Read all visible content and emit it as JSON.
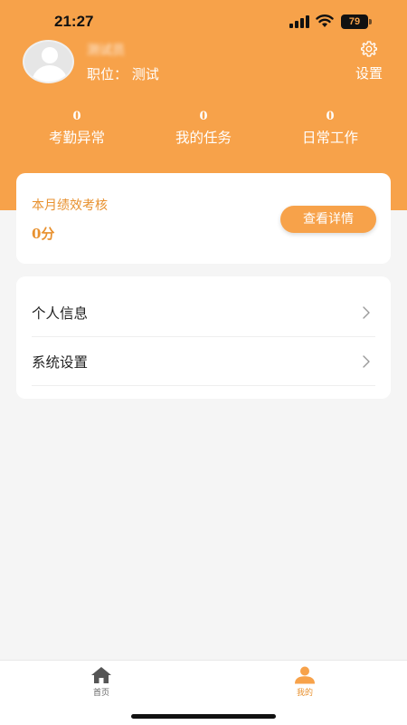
{
  "status_bar": {
    "time": "21:27",
    "battery": "79"
  },
  "profile": {
    "name": "测试员",
    "position_label": "职位：",
    "position_value": "测试",
    "settings_label": "设置"
  },
  "stats": [
    {
      "value": "0",
      "label": "考勤异常"
    },
    {
      "value": "0",
      "label": "我的任务"
    },
    {
      "value": "0",
      "label": "日常工作"
    }
  ],
  "performance": {
    "title": "本月绩效考核",
    "score": "0分",
    "button_label": "查看详情"
  },
  "menu": [
    {
      "label": "个人信息",
      "icon": "chevron-right-icon"
    },
    {
      "label": "系统设置",
      "icon": "chevron-right-icon"
    }
  ],
  "tabbar": [
    {
      "label": "首页",
      "icon": "home-icon",
      "active": false
    },
    {
      "label": "我的",
      "icon": "user-icon",
      "active": true
    }
  ],
  "colors": {
    "accent": "#f7a24a",
    "accent_text": "#e8912f",
    "background": "#f5f5f5"
  }
}
